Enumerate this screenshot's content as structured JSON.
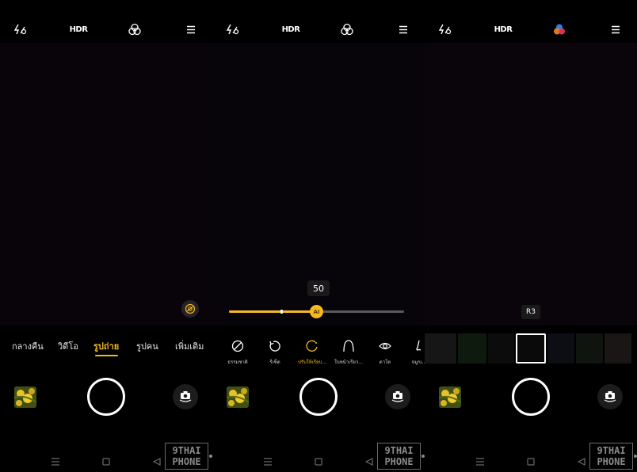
{
  "top_bar": {
    "flash_icon": "flash-auto-icon",
    "hdr_label": "HDR",
    "filter_icon": "filter-icon",
    "menu_icon": "menu-icon"
  },
  "panel_1": {
    "modes": [
      {
        "label": "กลางคืน",
        "active": false
      },
      {
        "label": "วิดีโอ",
        "active": false
      },
      {
        "label": "รูปถ่าย",
        "active": true
      },
      {
        "label": "รูปคน",
        "active": false
      },
      {
        "label": "เพิ่มเติม",
        "active": false
      }
    ],
    "lens_icon": "lens-switch-icon"
  },
  "panel_2": {
    "beauty_value": "50",
    "slider_fraction": 0.5,
    "slider_thumb_label": "AI",
    "beauty_options": [
      {
        "label": "ธรรมชาติ",
        "icon": "none-icon",
        "active": false
      },
      {
        "label": "รีเซ็ต",
        "icon": "reset-icon",
        "active": false
      },
      {
        "label": "ปรับให้เรียบ...",
        "icon": "smooth-icon",
        "active": true
      },
      {
        "label": "ใบหน้าเรียว...",
        "icon": "face-slim-icon",
        "active": false
      },
      {
        "label": "ตาโต",
        "icon": "eye-enlarge-icon",
        "active": false
      },
      {
        "label": "จมูกเ...",
        "icon": "nose-icon",
        "active": false
      }
    ]
  },
  "panel_3": {
    "filter_name": "R3",
    "swatch_colors": [
      "#161616",
      "#0e1a0d",
      "#0c0c0c",
      "#0a0a0a",
      "#0d0d14",
      "#0f140f",
      "#1a1616"
    ]
  },
  "bottom": {
    "gallery_icon": "gallery-thumbnail",
    "shutter_icon": "shutter-button",
    "flip_icon": "camera-flip-icon"
  },
  "navbar": {
    "recent_icon": "recent-apps-icon",
    "home_icon": "home-icon",
    "back_icon": "back-icon"
  },
  "watermark": {
    "line1": "9THAI",
    "line2": "PHONE"
  },
  "colors": {
    "accent": "#f5b921",
    "background": "#000000"
  }
}
